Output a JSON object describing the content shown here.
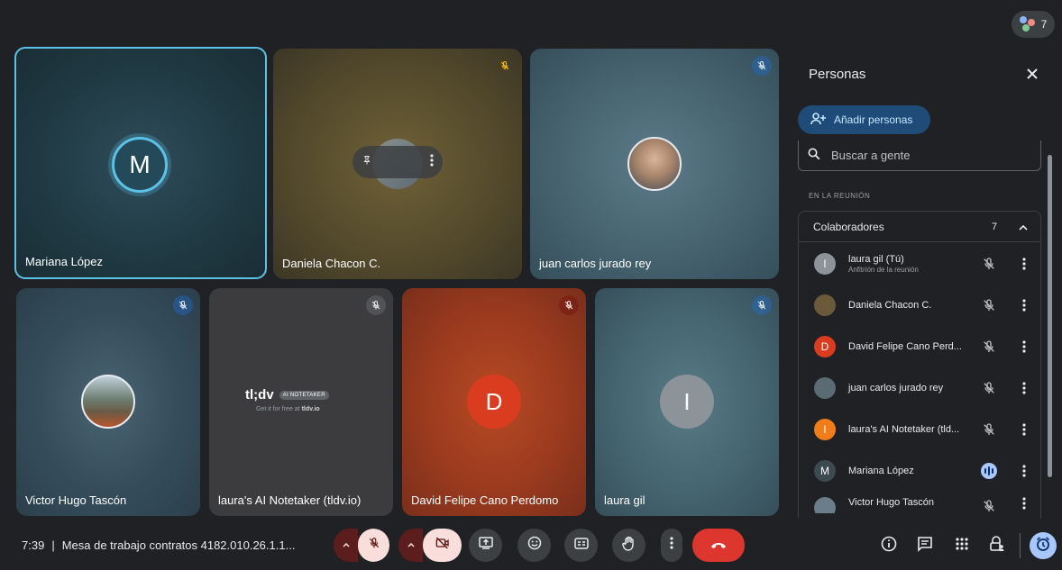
{
  "top_bar": {
    "participant_count": "7"
  },
  "tiles": {
    "mariana": {
      "name": "Mariana López",
      "initial": "M"
    },
    "daniela": {
      "name": "Daniela Chacon C."
    },
    "juan": {
      "name": "juan carlos jurado rey"
    },
    "victor": {
      "name": "Victor Hugo Tascón"
    },
    "tldv": {
      "name": "laura's AI Notetaker (tldv.io)",
      "brand": "tl;dv",
      "tag": "AI NOTETAKER",
      "sub_prefix": "Get it for free at",
      "sub_link": "tldv.io"
    },
    "david": {
      "name": "David Felipe Cano Perdomo",
      "initial": "D"
    },
    "laura": {
      "name": "laura gil",
      "initial": "I"
    }
  },
  "panel": {
    "title": "Personas",
    "add_label": "Añadir personas",
    "search_placeholder": "Buscar a gente",
    "section_label": "EN LA REUNIÓN",
    "group_label": "Colaboradores",
    "group_count": "7",
    "people": [
      {
        "name": "laura gil (Tú)",
        "sub": "Anfitrión de la reunión",
        "initial": "l",
        "color": "#8d9499"
      },
      {
        "name": "Daniela Chacon C.",
        "sub": "",
        "initial": "",
        "color": "#6b5a3a"
      },
      {
        "name": "David Felipe Cano Perd...",
        "sub": "",
        "initial": "D",
        "color": "#d93c1e"
      },
      {
        "name": "juan carlos jurado rey",
        "sub": "",
        "initial": "",
        "color": "#5b6b74"
      },
      {
        "name": "laura's AI Notetaker (tld...",
        "sub": "",
        "initial": "l",
        "color": "#f07c1a"
      },
      {
        "name": "Mariana López",
        "sub": "",
        "initial": "M",
        "color": "#3c4a52"
      },
      {
        "name": "Victor Hugo Tascón",
        "sub": "",
        "initial": "",
        "color": "#6a7d88"
      }
    ]
  },
  "bottom": {
    "time": "7:39",
    "separator": "|",
    "meeting_title": "Mesa de trabajo contratos 4182.010.26.1.1..."
  },
  "colors": {
    "accent": "#5bc1e6",
    "end_call": "#dc362e",
    "muted_bg": "#f9dedc"
  }
}
